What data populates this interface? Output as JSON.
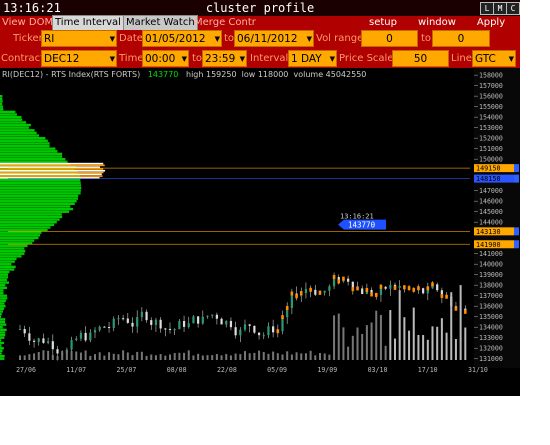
{
  "clock": "13:16:21",
  "window_title": "cluster profile",
  "window_buttons": [
    "L",
    "M",
    "C"
  ],
  "tabs": [
    "View DOM",
    "Time Interval",
    "Market Watch",
    "Merge Contr"
  ],
  "menu": [
    "setup",
    "window",
    "Apply"
  ],
  "row1": {
    "ticker_label": "Ticker",
    "ticker": "RI",
    "date_label": "Date",
    "date_from": "01/05/2012",
    "to_label": "to",
    "date_to": "06/11/2012",
    "vol_label": "Vol range",
    "vol_from": "0",
    "vol_to_label": "to",
    "vol_to": "0"
  },
  "row2": {
    "contract_label": "Contract",
    "contract": "DEC12",
    "time_label": "Time",
    "time_from": "00:00",
    "to_label": "to",
    "time_to": "23:59",
    "interval_label": "Interval",
    "interval": "1 DAY",
    "price_scale_label": "Price Scale",
    "price_scale": "50",
    "line_label": "Line",
    "line": "GTC"
  },
  "legend": {
    "instrument": "RI(DEC12) - RTS Index(RTS FORTS)",
    "last": "143770",
    "high": "high 159250",
    "low": "low 118000",
    "volume": "volume 45042550"
  },
  "chart_data": {
    "type": "candlestick",
    "x_labels": [
      "27/06",
      "11/07",
      "25/07",
      "08/08",
      "22/08",
      "05/09",
      "19/09",
      "03/10",
      "17/10",
      "31/10"
    ],
    "y_ticks": [
      131000,
      132000,
      133000,
      134000,
      135000,
      136000,
      137000,
      138000,
      139000,
      140000,
      141000,
      142000,
      143000,
      144000,
      145000,
      146000,
      147000,
      148000,
      149000,
      150000,
      151000,
      152000,
      153000,
      154000,
      155000,
      156000,
      157000,
      158000
    ],
    "ylim": [
      130500,
      158300
    ],
    "last_price": "143770",
    "last_time": "13:16:21",
    "levels": [
      {
        "price": "149150",
        "y": 149150,
        "color": "#ffa800"
      },
      {
        "price": "148150",
        "y": 148150,
        "color": "#2a55ff"
      },
      {
        "price": "143130",
        "y": 143130,
        "color": "#ffa800"
      },
      {
        "price": "141900",
        "y": 141900,
        "color": "#ffa800"
      }
    ],
    "grid": false
  },
  "colors": {
    "bg": "#000000",
    "header": "#b00000",
    "field": "#ffa800",
    "profile": "#00cc00",
    "candle": "#dddddd",
    "cluster": "#ff8c00",
    "level_blue": "#2a55ff"
  }
}
